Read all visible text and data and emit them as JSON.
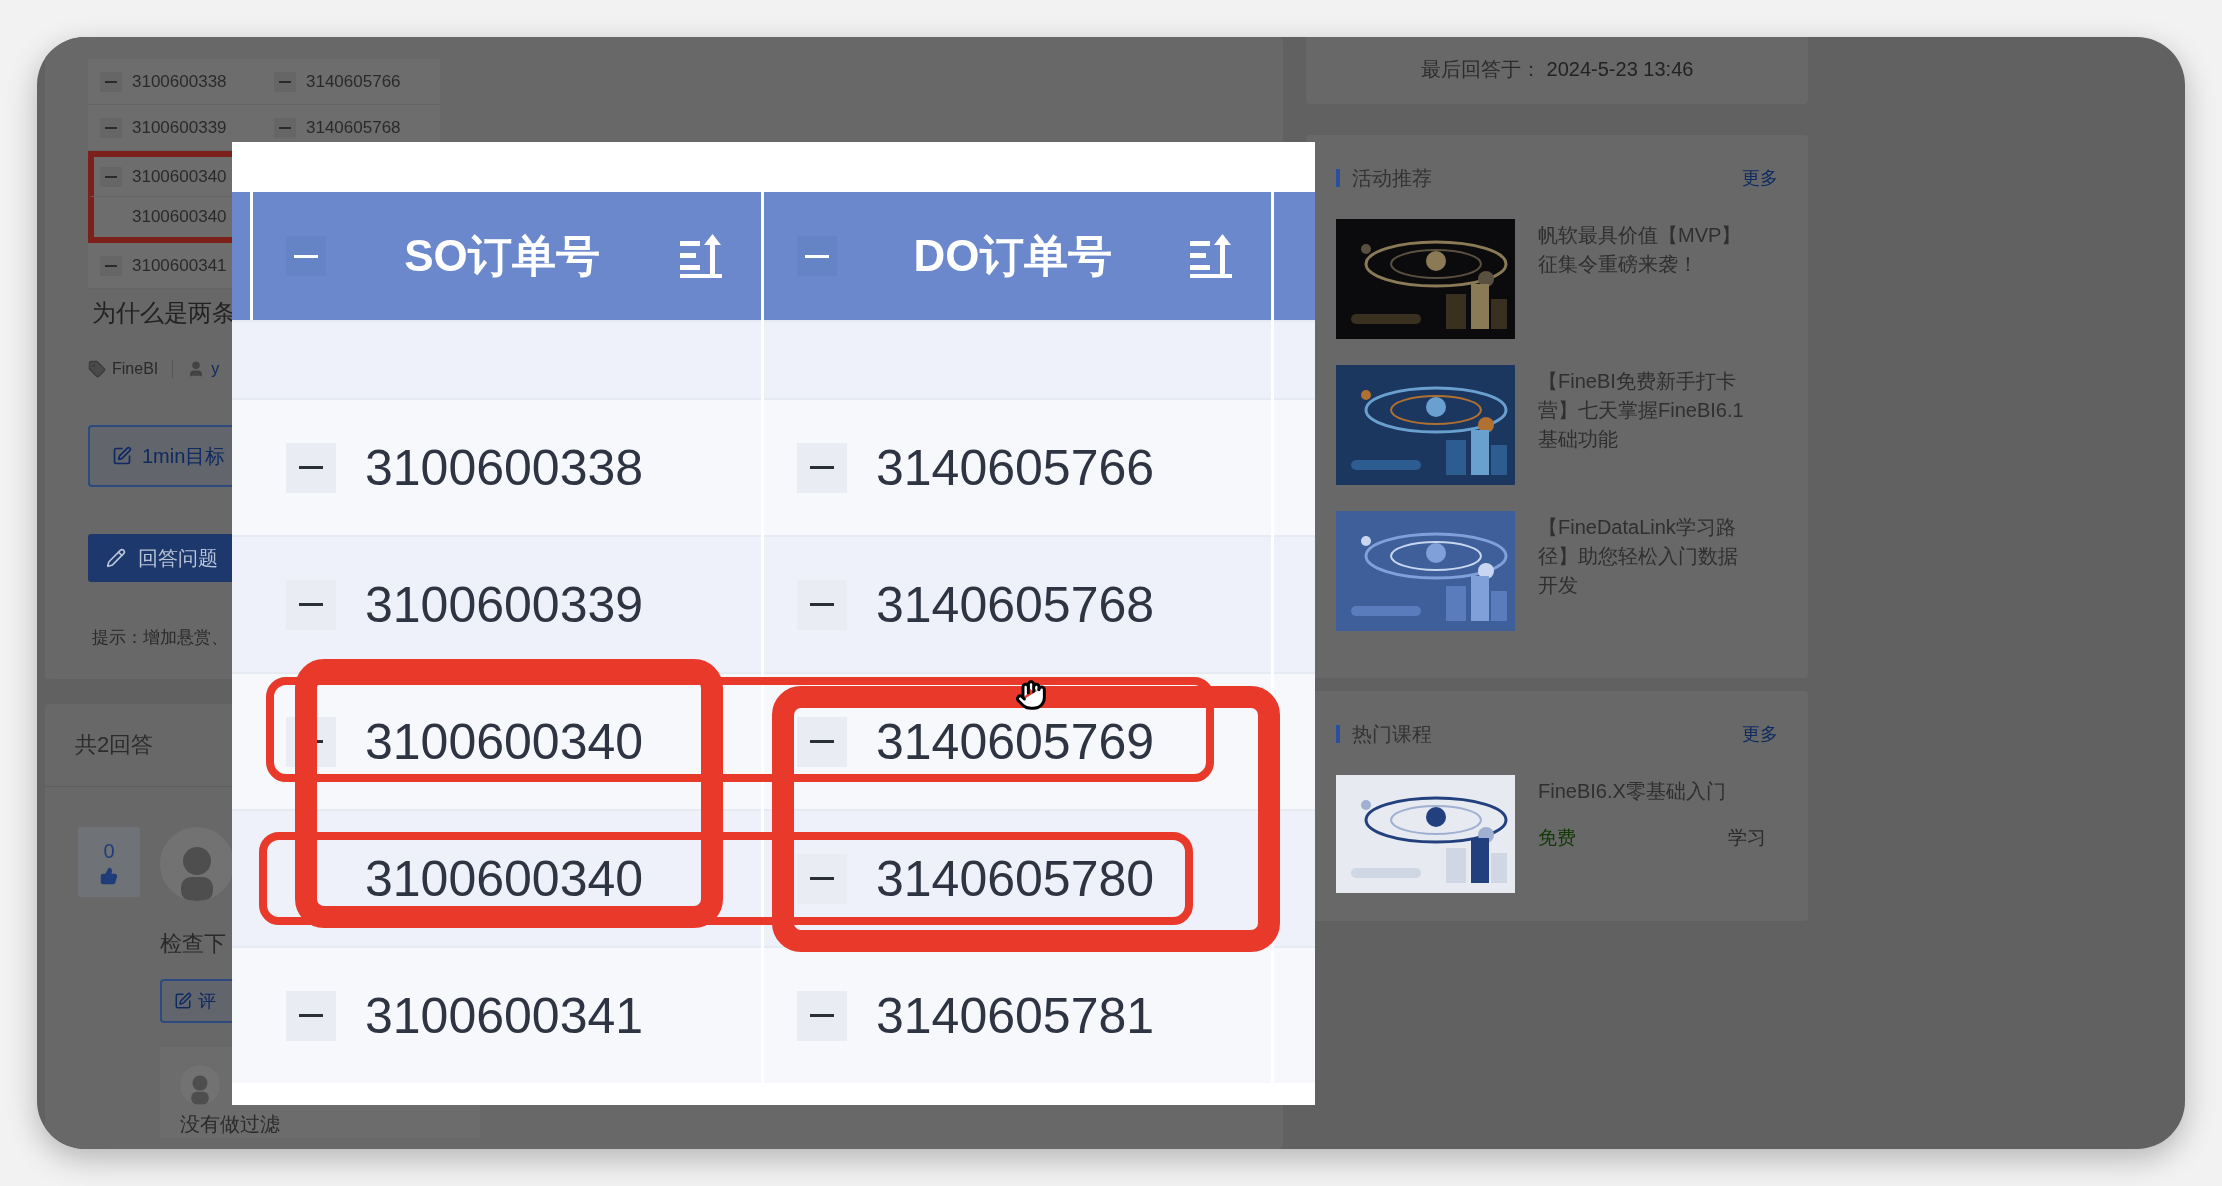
{
  "question": {
    "preview_table": {
      "rows": [
        {
          "marked": false,
          "cells": [
            {
              "text": "3100600338",
              "collapsible": true
            },
            {
              "text": "3140605766",
              "collapsible": true
            }
          ]
        },
        {
          "marked": false,
          "cells": [
            {
              "text": "3100600339",
              "collapsible": true
            },
            {
              "text": "3140605768",
              "collapsible": true
            }
          ]
        },
        {
          "marked": true,
          "cells": [
            {
              "text": "3100600340",
              "collapsible": true
            }
          ]
        },
        {
          "marked": true,
          "cells": [
            {
              "text": "3100600340",
              "collapsible": false
            }
          ]
        },
        {
          "marked": false,
          "cells": [
            {
              "text": "3100600341",
              "collapsible": true
            }
          ]
        }
      ]
    },
    "title": "为什么是两条",
    "tag": "FineBI",
    "author": "y",
    "target_button": "1min目标",
    "answer_button": "回答问题",
    "hint": "提示：增加悬赏、"
  },
  "answers": {
    "count_label": "共2回答",
    "items": [
      {
        "votes": "0",
        "text": "检查下",
        "comment_button": "评",
        "reply": {
          "text": "没有做过滤"
        }
      }
    ]
  },
  "sidebar": {
    "last_answer": {
      "label": "最后回答于：",
      "time": "2024-5-23 13:46"
    },
    "sections": [
      {
        "kind": "activities",
        "title": "活动推荐",
        "more": "更多",
        "items": [
          {
            "title": "帆软最具价值【MVP】征集令重磅来袭！"
          },
          {
            "title": "【FineBI免费新手打卡营】七天掌握FineBI6.1基础功能"
          },
          {
            "title": "【FineDataLink学习路径】助您轻松入门数据开发"
          }
        ]
      },
      {
        "kind": "courses",
        "title": "热门课程",
        "more": "更多",
        "items": [
          {
            "title": "FineBI6.X零基础入门",
            "price": "免费",
            "action": "学习"
          }
        ]
      }
    ]
  },
  "image_viewer": {
    "columns": [
      {
        "title": "SO订单号"
      },
      {
        "title": "DO订单号"
      }
    ],
    "rows": [
      {
        "cells": [
          {
            "text": "3100600338",
            "collapsible": true
          },
          {
            "text": "3140605766",
            "collapsible": true
          }
        ]
      },
      {
        "cells": [
          {
            "text": "3100600339",
            "collapsible": true
          },
          {
            "text": "3140605768",
            "collapsible": true
          }
        ]
      },
      {
        "cells": [
          {
            "text": "3100600340",
            "collapsible": true
          },
          {
            "text": "3140605769",
            "collapsible": true
          }
        ]
      },
      {
        "cells": [
          {
            "text": "3100600340",
            "collapsible": false
          },
          {
            "text": "3140605780",
            "collapsible": true
          }
        ]
      },
      {
        "cells": [
          {
            "text": "3100600341",
            "collapsible": true
          },
          {
            "text": "3140605781",
            "collapsible": true
          }
        ]
      }
    ]
  }
}
